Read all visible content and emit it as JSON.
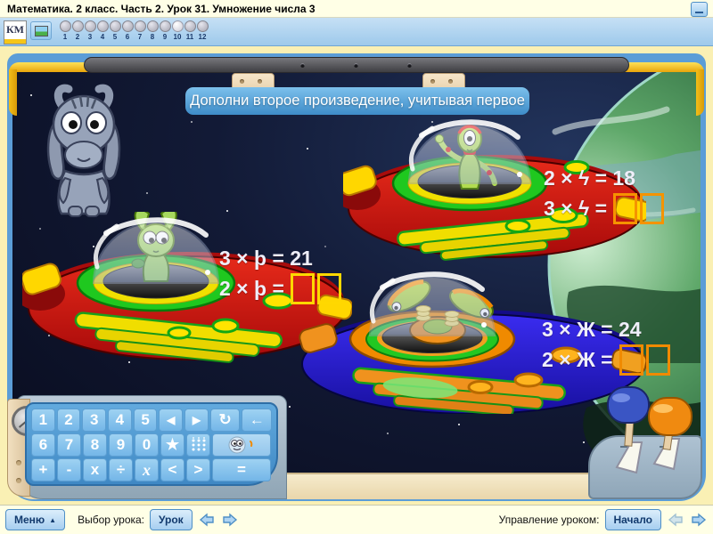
{
  "window": {
    "title": "Математика. 2 класс. Часть 2. Урок 31. Умножение числа 3",
    "minimize_icon": "dash-icon"
  },
  "toolbar": {
    "logo_text": "КМ",
    "picture_button_icon": "picture-icon",
    "active_slide": "10",
    "slides": [
      "1",
      "2",
      "3",
      "4",
      "5",
      "6",
      "7",
      "8",
      "9",
      "10",
      "11",
      "12"
    ]
  },
  "scene": {
    "instruction": "Дополни второе произведение, учитывая первое",
    "problems": [
      {
        "position": "left-ufo",
        "line1": "3 × þ = 21",
        "line2": "2 × þ =",
        "answers": [
          "",
          ""
        ],
        "box_border": "#FFD800"
      },
      {
        "position": "top-right-ufo",
        "line1": "2 × ϟ = 18",
        "line2": "3 × ϟ =",
        "answers": [
          "",
          ""
        ],
        "box_border": "#F59300"
      },
      {
        "position": "bottom-right-ufo",
        "line1": "3 × Ж = 24",
        "line2": "2 × Ж =",
        "answers": [
          "",
          ""
        ],
        "box_border": "#F08A00"
      }
    ]
  },
  "numpad": {
    "r1": [
      "1",
      "2",
      "3",
      "4",
      "5",
      "◀",
      "▶",
      "↻",
      "←"
    ],
    "r2": [
      "6",
      "7",
      "8",
      "9",
      "0",
      "★"
    ],
    "r2_icon_keys": [
      "dots-grid-icon",
      "smiley-face-icon"
    ],
    "r3": [
      "+",
      "-",
      "x",
      "÷",
      "x",
      "<",
      ">",
      "="
    ]
  },
  "footer": {
    "menu_label": "Меню",
    "menu_arrow": "▲",
    "lesson_select_label": "Выбор урока:",
    "lesson_button": "Урок",
    "control_label": "Управление уроком:",
    "control_button": "Начало"
  },
  "colors": {
    "ufo_red": "#DC1616",
    "ufo_blue": "#2B1EE0",
    "accent_blue": "#5B9DD7",
    "panel_key_blue": "#74B6E8",
    "page_bg": "#FAF0B4"
  }
}
